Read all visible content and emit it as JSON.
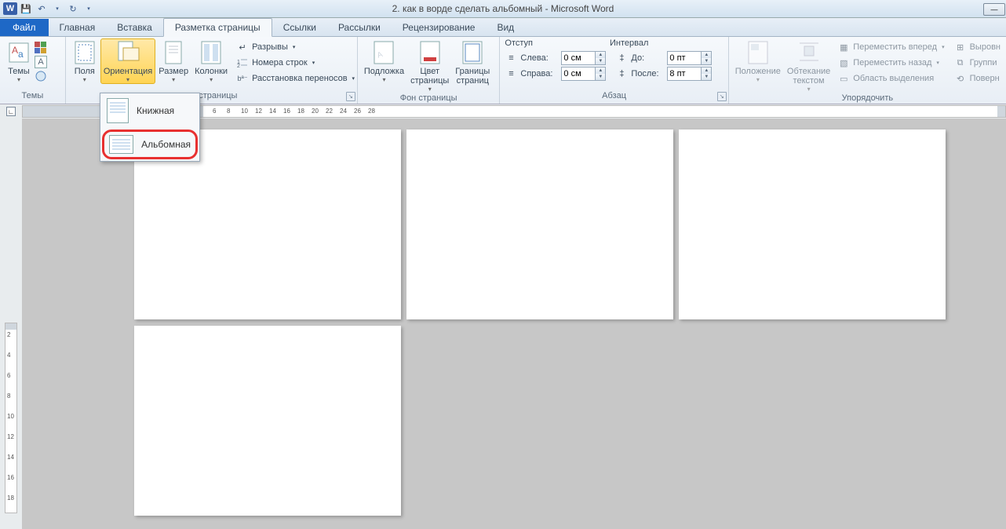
{
  "title": "2. как в ворде сделать альбомный - Microsoft Word",
  "tabs": {
    "file": "Файл",
    "home": "Главная",
    "insert": "Вставка",
    "layout": "Разметка страницы",
    "refs": "Ссылки",
    "mail": "Рассылки",
    "review": "Рецензирование",
    "view": "Вид"
  },
  "groups": {
    "themes": {
      "label": "Темы",
      "themes_btn": "Темы"
    },
    "page_setup": {
      "label": "ры страницы",
      "margins": "Поля",
      "orientation": "Ориентация",
      "size": "Размер",
      "columns": "Колонки",
      "breaks": "Разрывы",
      "line_numbers": "Номера строк",
      "hyphenation": "Расстановка переносов"
    },
    "page_bg": {
      "label": "Фон страницы",
      "watermark": "Подложка",
      "page_color": "Цвет\nстраницы",
      "borders": "Границы\nстраниц"
    },
    "paragraph": {
      "label": "Абзац",
      "indent_title": "Отступ",
      "spacing_title": "Интервал",
      "left_label": "Слева:",
      "right_label": "Справа:",
      "before_label": "До:",
      "after_label": "После:",
      "left": "0 см",
      "right": "0 см",
      "before": "0 пт",
      "after": "8 пт"
    },
    "arrange": {
      "label": "Упорядочить",
      "position": "Положение",
      "wrap": "Обтекание\nтекстом",
      "bring_fwd": "Переместить вперед",
      "send_back": "Переместить назад",
      "selection_pane": "Область выделения",
      "align": "Выровн",
      "group": "Группи",
      "rotate": "Поверн"
    }
  },
  "orientation_menu": {
    "portrait": "Книжная",
    "landscape": "Альбомная"
  },
  "ruler_marks": [
    "6",
    "8",
    "10",
    "12",
    "14",
    "16",
    "18",
    "20",
    "22",
    "24",
    "26",
    "28"
  ],
  "vruler_marks": [
    "2",
    "4",
    "6",
    "8",
    "10",
    "12",
    "14",
    "16",
    "18"
  ]
}
